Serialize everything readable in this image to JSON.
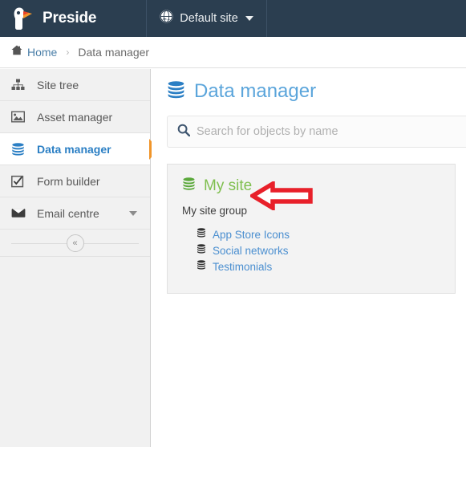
{
  "topbar": {
    "brand_name": "Preside",
    "brand_logo_icon": "parrot-logo-icon",
    "site_select_label": "Default site",
    "site_select_icon": "globe-icon",
    "caret_icon": "caret-down-icon"
  },
  "breadcrumb": {
    "home_icon": "home-icon",
    "home_label": "Home",
    "separator": "›",
    "current_label": "Data manager"
  },
  "sidebar": {
    "items": [
      {
        "label": "Site tree",
        "icon": "sitemap-icon",
        "active": false,
        "expandable": false
      },
      {
        "label": "Asset manager",
        "icon": "image-icon",
        "active": false,
        "expandable": false
      },
      {
        "label": "Data manager",
        "icon": "database-icon",
        "active": true,
        "expandable": false
      },
      {
        "label": "Form builder",
        "icon": "checkbox-checked-icon",
        "active": false,
        "expandable": false
      },
      {
        "label": "Email centre",
        "icon": "envelope-icon",
        "active": false,
        "expandable": true
      }
    ],
    "collapse_label": "«",
    "collapse_icon": "double-chevron-left-icon"
  },
  "main": {
    "page_title": "Data manager",
    "page_title_icon": "database-icon",
    "search": {
      "icon": "search-icon",
      "placeholder": "Search for objects by name",
      "value": ""
    },
    "group_card": {
      "title": "My site",
      "title_icon": "database-icon",
      "subtitle": "My site group",
      "objects": [
        {
          "label": "App Store Icons",
          "icon": "database-icon"
        },
        {
          "label": "Social networks",
          "icon": "database-icon"
        },
        {
          "label": "Testimonials",
          "icon": "database-icon"
        }
      ]
    },
    "annotation": {
      "icon": "red-left-arrow-annotation-icon",
      "color": "#e8202a"
    }
  },
  "colors": {
    "topbar_bg": "#2b3e50",
    "sidebar_bg": "#f1f1f1",
    "active_accent": "#f0952a",
    "link_blue": "#4b8fd0",
    "title_blue": "#5ba5db",
    "group_green": "#7fbf4f",
    "annotation_red": "#e8202a"
  }
}
